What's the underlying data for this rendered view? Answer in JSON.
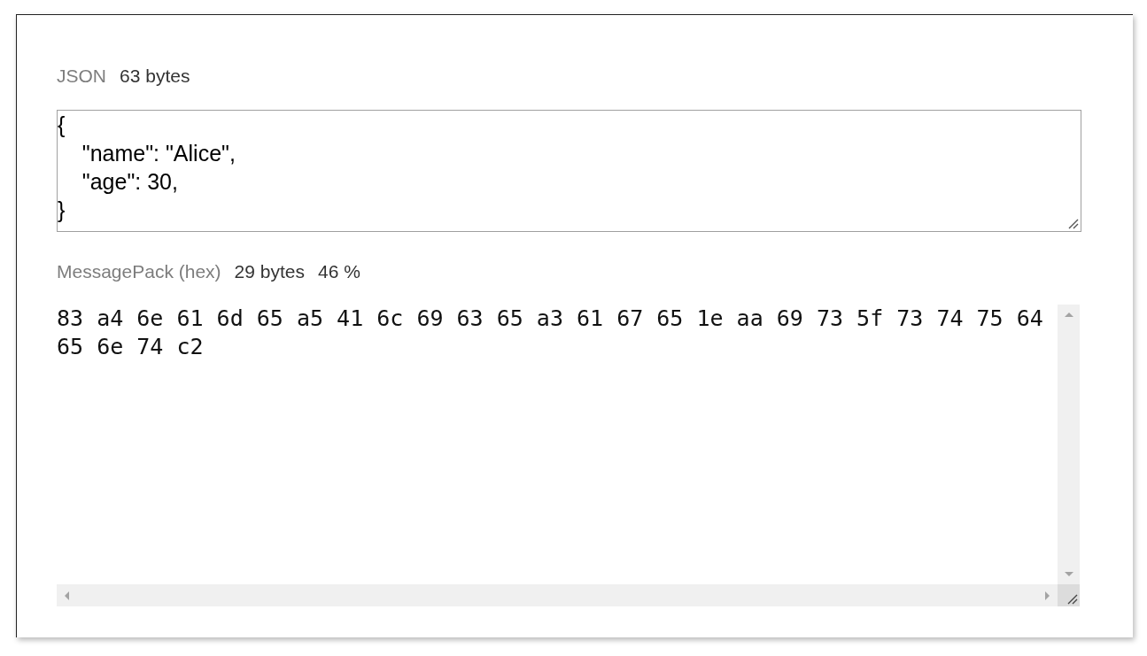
{
  "json_section": {
    "label": "JSON",
    "size": "63 bytes",
    "input": {
      "value": "{\n    \"name\": \"Alice\",\n    \"age\": 30,\n}"
    }
  },
  "messagepack_section": {
    "label": "MessagePack (hex)",
    "size": "29 bytes",
    "ratio": "46 %",
    "output": {
      "value": "83 a4 6e 61 6d 65 a5 41 6c 69 63 65 a3 61 67 65 1e aa 69 73 5f 73 74 75 64 65 6e 74 c2"
    }
  }
}
